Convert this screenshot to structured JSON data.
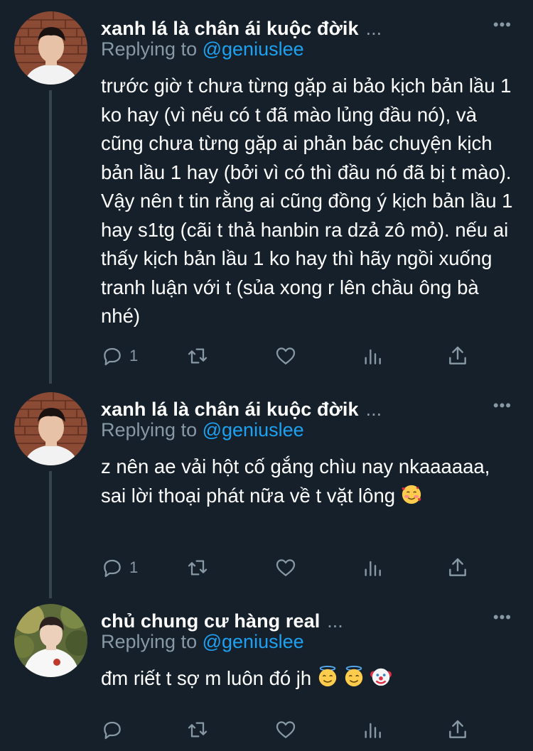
{
  "colors": {
    "background": "#15202b",
    "text": "#ffffff",
    "secondary": "#8899a6",
    "link": "#1da1f2",
    "line": "#38444d"
  },
  "tweets": [
    {
      "author": "xanh lá là chân ái kuộc đờik",
      "ellipsis": "...",
      "more": "•••",
      "replying_prefix": "Replying to",
      "replying_handle": "@geniuslee",
      "text": "trước giờ t chưa từng gặp ai bảo kịch bản lầu 1 ko hay (vì nếu có t đã mào lủng đầu nó), và cũng chưa từng gặp ai phản bác chuyện kịch bản lầu 1 hay (bởi vì có thì đầu nó đã bị t mào). Vậy nên t tin rằng ai cũng đồng ý kịch bản lầu 1 hay s1tg (cãi t thả hanbin ra dzả zô mỏ). nếu ai thấy kịch bản lầu 1 ko hay thì hãy ngồi xuống tranh luận với t (sủa xong r lên chầu ông bà nhé)",
      "emojis": [],
      "reply_count": "1"
    },
    {
      "author": "xanh lá là chân ái kuộc đờik",
      "ellipsis": "...",
      "more": "•••",
      "replying_prefix": "Replying to",
      "replying_handle": "@geniuslee",
      "text": "z nên ae vải hột cố gắng chìu nay nkaaaaaa, sai lời thoại phát nữa về t vặt lông",
      "emojis": [
        "smiling-face-with-hearts"
      ],
      "reply_count": "1"
    },
    {
      "author": "chủ chung cư hàng real",
      "ellipsis": "...",
      "more": "•••",
      "replying_prefix": "Replying to",
      "replying_handle": "@geniuslee",
      "text": "đm riết t sợ m luôn đó jh",
      "emojis": [
        "smiling-face-with-halo",
        "smiling-face-with-halo",
        "clown-face"
      ],
      "reply_count": ""
    }
  ]
}
